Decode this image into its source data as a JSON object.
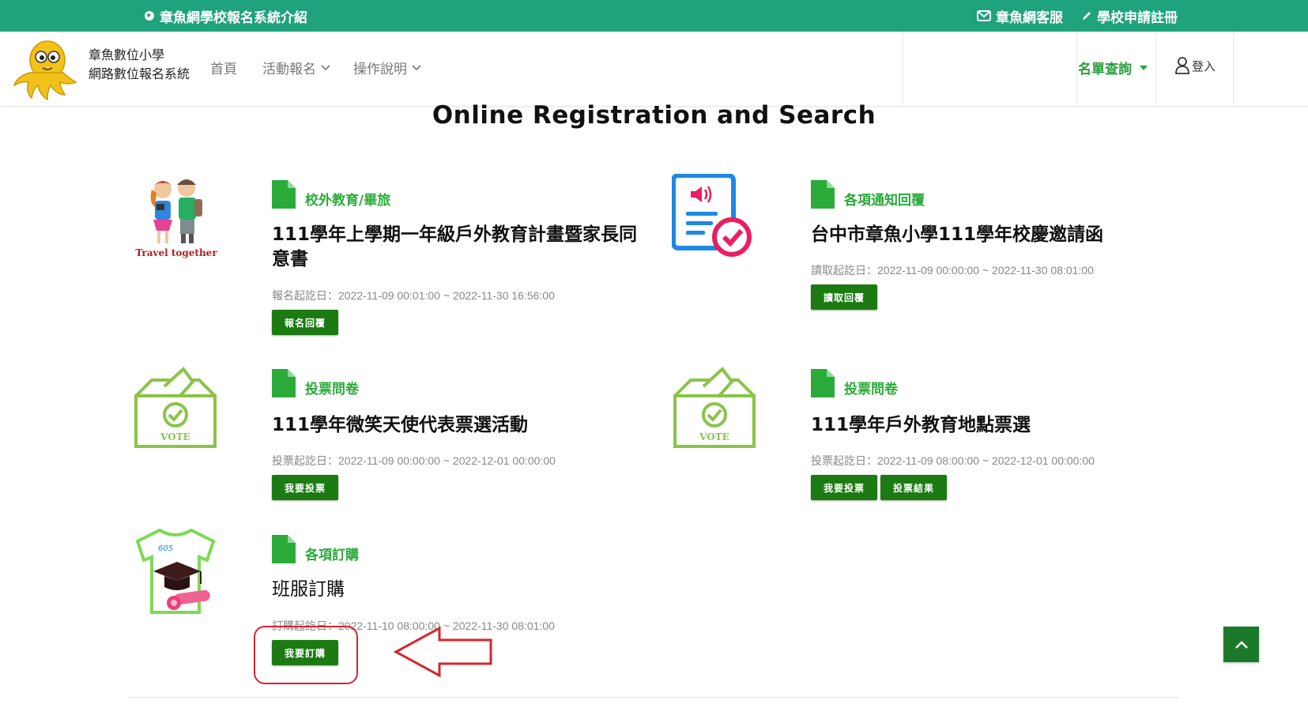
{
  "topbar": {
    "intro_link": "章魚網學校報名系統介紹",
    "support_link": "章魚網客服",
    "register_link": "學校申請註冊"
  },
  "header": {
    "brand_line1": "章魚數位小學",
    "brand_line2": "網路數位報名系統",
    "nav": {
      "home": "首頁",
      "activity": "活動報名",
      "guide": "操作說明"
    },
    "roster": "名單查詢",
    "login": "登入"
  },
  "main": {
    "title": "Online Registration and Search",
    "cards": [
      {
        "category": "校外教育/畢旅",
        "title": "111學年上學期一年級戶外教育計畫暨家長同意書",
        "date": "報名起訖日：2022-11-09 00:01:00 ~ 2022-11-30 16:56:00",
        "buttons": [
          "報名回覆"
        ],
        "image_caption": "Travel together",
        "icon": "travel-icon"
      },
      {
        "category": "各項通知回覆",
        "title": "台中市章魚小學111學年校慶邀請函",
        "date": "讀取起訖日：2022-11-09 00:00:00 ~ 2022-11-30 08:01:00",
        "buttons": [
          "讀取回覆"
        ],
        "icon": "notice-document-icon"
      },
      {
        "category": "投票問卷",
        "title": "111學年微笑天使代表票選活動",
        "date": "投票起訖日：2022-11-09 00:00:00 ~ 2022-12-01 00:00:00",
        "buttons": [
          "我要投票"
        ],
        "image_caption": "VOTE",
        "icon": "vote-box-icon"
      },
      {
        "category": "投票問卷",
        "title": "111學年戶外教育地點票選",
        "date": "投票起訖日：2022-11-09 08:00:00 ~ 2022-12-01 00:00:00",
        "buttons": [
          "我要投票",
          "投票結果"
        ],
        "image_caption": "VOTE",
        "icon": "vote-box-icon"
      },
      {
        "category": "各項訂購",
        "title": "班服訂購",
        "date": "訂購起訖日：2022-11-10 08:00:00 ~ 2022-11-30 08:01:00",
        "buttons": [
          "我要訂購"
        ],
        "image_caption": "605",
        "icon": "tshirt-icon"
      }
    ]
  },
  "colors": {
    "topbar_bg": "#1fa37c",
    "category_green": "#2aab3a",
    "button_green": "#1b7a12",
    "annotation_red": "#d6262c"
  }
}
